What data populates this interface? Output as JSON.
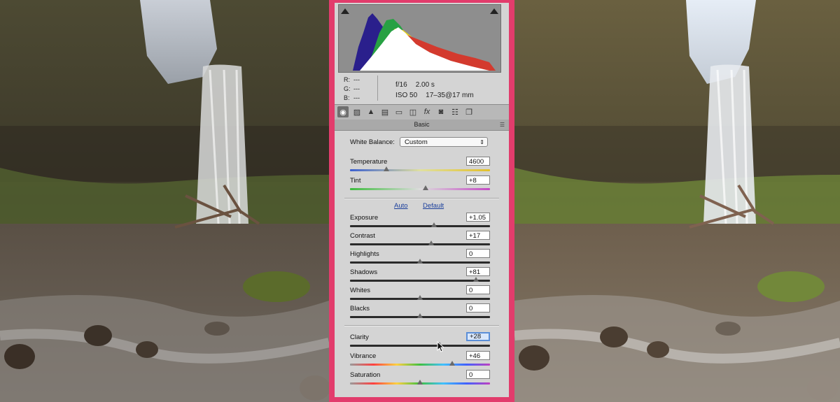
{
  "histogram": {
    "rgb": [
      {
        "label": "R:",
        "value": "---"
      },
      {
        "label": "G:",
        "value": "---"
      },
      {
        "label": "B:",
        "value": "---"
      }
    ],
    "aperture": "f/16",
    "shutter": "2.00 s",
    "iso": "ISO 50",
    "lens": "17–35@17 mm"
  },
  "tabs": [
    {
      "name": "basic",
      "glyph": "◉"
    },
    {
      "name": "tone-curve",
      "glyph": "▨"
    },
    {
      "name": "detail",
      "glyph": "▲"
    },
    {
      "name": "hsl",
      "glyph": "▤"
    },
    {
      "name": "split-toning",
      "glyph": "▭"
    },
    {
      "name": "lens-corrections",
      "glyph": "◫"
    },
    {
      "name": "effects",
      "glyph": "fx"
    },
    {
      "name": "camera-calibration",
      "glyph": "◙"
    },
    {
      "name": "presets",
      "glyph": "☷"
    },
    {
      "name": "snapshots",
      "glyph": "❐"
    }
  ],
  "section_title": "Basic",
  "white_balance": {
    "label": "White Balance:",
    "value": "Custom"
  },
  "auto_label": "Auto",
  "default_label": "Default",
  "sliders": {
    "temperature": {
      "label": "Temperature",
      "value": "4600",
      "position": 0.26
    },
    "tint": {
      "label": "Tint",
      "value": "+8",
      "position": 0.54
    },
    "exposure": {
      "label": "Exposure",
      "value": "+1.05",
      "position": 0.6
    },
    "contrast": {
      "label": "Contrast",
      "value": "+17",
      "position": 0.58
    },
    "highlights": {
      "label": "Highlights",
      "value": "0",
      "position": 0.5
    },
    "shadows": {
      "label": "Shadows",
      "value": "+81",
      "position": 0.9
    },
    "whites": {
      "label": "Whites",
      "value": "0",
      "position": 0.5
    },
    "blacks": {
      "label": "Blacks",
      "value": "0",
      "position": 0.5
    },
    "clarity": {
      "label": "Clarity",
      "value": "+28",
      "position": 0.64
    },
    "vibrance": {
      "label": "Vibrance",
      "value": "+46",
      "position": 0.73
    },
    "saturation": {
      "label": "Saturation",
      "value": "0",
      "position": 0.5
    }
  },
  "colors": {
    "frame": "#e23c6c",
    "panel": "#d4d4d4",
    "link": "#1b3f9c"
  }
}
